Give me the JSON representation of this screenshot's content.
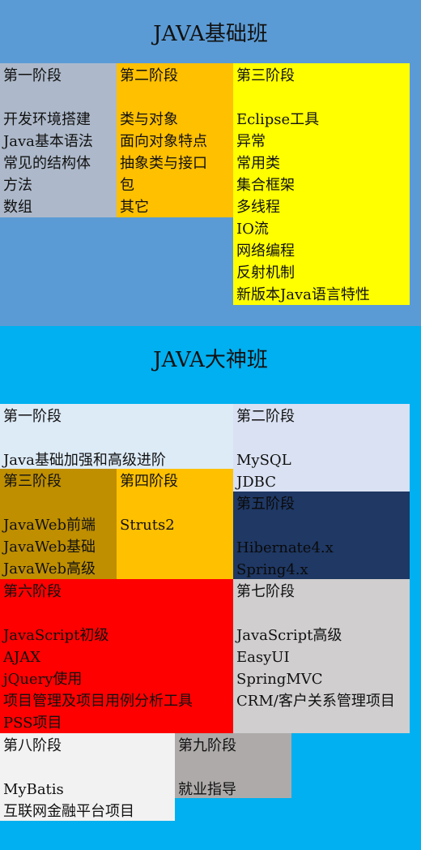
{
  "colors": {
    "basic_bg": "#5b9bd5",
    "master_bg": "#00b0f0",
    "gray_blue": "#adb9ca",
    "orange": "#ffc000",
    "yellow": "#ffff00",
    "light_blue": "#ddebf7",
    "lavender": "#d9e1f2",
    "dark_gold": "#bf8f00",
    "navy": "#1f3864",
    "red": "#ff0000",
    "light_gray": "#d0cece",
    "off_white": "#f2f2f2",
    "mid_gray": "#aeaaaa"
  },
  "basic": {
    "title": "JAVA基础班",
    "stage1": {
      "header": "第一阶段",
      "items": [
        "开发环境搭建",
        "Java基本语法",
        "常见的结构体",
        "方法",
        "数组"
      ]
    },
    "stage2": {
      "header": "第二阶段",
      "items": [
        "类与对象",
        "面向对象特点",
        "抽象类与接口",
        "包",
        "其它"
      ]
    },
    "stage3": {
      "header": "第三阶段",
      "items": [
        "Eclipse工具",
        "异常",
        "常用类",
        "集合框架",
        "多线程",
        "IO流",
        "网络编程",
        "反射机制",
        "新版本Java语言特性"
      ]
    }
  },
  "master": {
    "title": "JAVA大神班",
    "stage1": {
      "header": "第一阶段",
      "items": [
        "Java基础加强和高级进阶"
      ]
    },
    "stage2": {
      "header": "第二阶段",
      "items": [
        "MySQL",
        "JDBC"
      ]
    },
    "stage3": {
      "header": "第三阶段",
      "items": [
        "JavaWeb前端",
        "JavaWeb基础",
        "JavaWeb高级"
      ]
    },
    "stage4": {
      "header": "第四阶段",
      "items": [
        "Struts2"
      ]
    },
    "stage5": {
      "header": "第五阶段",
      "items": [
        "Hibernate4.x",
        "Spring4.x"
      ]
    },
    "stage6": {
      "header": "第六阶段",
      "items": [
        "JavaScript初级",
        "AJAX",
        "jQuery使用",
        "项目管理及项目用例分析工具",
        "PSS项目"
      ]
    },
    "stage7": {
      "header": "第七阶段",
      "items": [
        "JavaScript高级",
        "EasyUI",
        "SpringMVC",
        "CRM/客户关系管理项目"
      ]
    },
    "stage8": {
      "header": "第八阶段",
      "items": [
        "MyBatis",
        "互联网金融平台项目"
      ]
    },
    "stage9": {
      "header": "第九阶段",
      "items": [
        "就业指导"
      ]
    }
  }
}
